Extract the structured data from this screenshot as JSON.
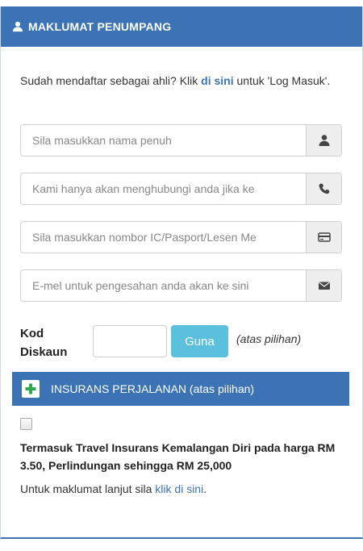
{
  "panel": {
    "title": "MAKLUMAT PENUMPANG",
    "title_icon": "user-icon"
  },
  "intro": {
    "text_before": "Sudah mendaftar sebagai ahli? Klik ",
    "link": "di sini",
    "text_after": " untuk 'Log Masuk'."
  },
  "fields": {
    "name": {
      "placeholder": "Sila masukkan nama penuh",
      "icon": "user-icon"
    },
    "phone": {
      "placeholder": "Kami hanya akan menghubungi anda jika ke",
      "icon": "phone-icon"
    },
    "ic": {
      "placeholder": "Sila masukkan nombor IC/Pasport/Lesen Me",
      "icon": "id-card-icon"
    },
    "email": {
      "placeholder": "E-mel untuk pengesahan anda akan ke sini",
      "icon": "envelope-icon"
    }
  },
  "discount": {
    "label_line1": "Kod",
    "label_line2": "Diskaun",
    "value": "",
    "button": "Guna",
    "note": "(atas pilihan)"
  },
  "insurance": {
    "header": "INSURANS PERJALANAN (atas pilihan)",
    "header_icon": "plus-icon",
    "checked": false,
    "description": "Termasuk Travel Insurans Kemalangan Diri pada harga RM 3.50, Perlindungan sehingga RM 25,000",
    "more_text": "Untuk maklumat lanjut sila ",
    "more_link": "klik di sini",
    "more_end": "."
  },
  "colors": {
    "primary": "#3b73b5",
    "button_info": "#5bc0de",
    "plus_green": "#2fa84f"
  }
}
